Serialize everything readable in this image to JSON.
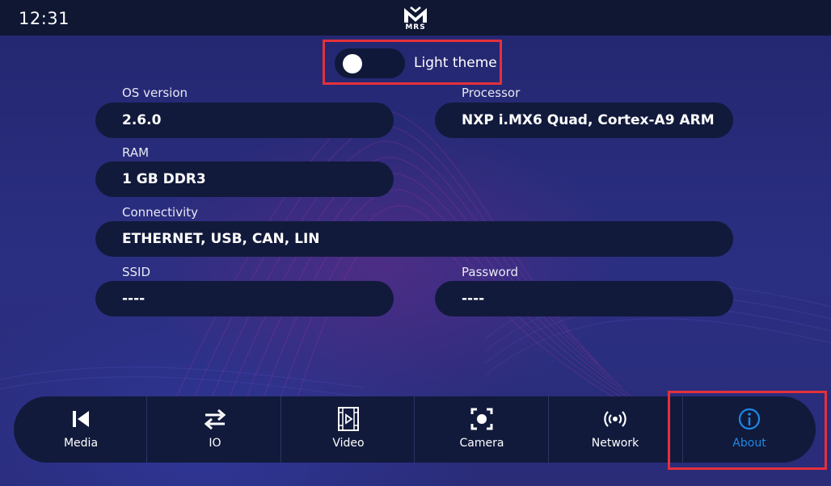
{
  "status_bar": {
    "time": "12:31",
    "logo_text": "MRS"
  },
  "theme_toggle": {
    "label": "Light theme",
    "state": "off"
  },
  "fields": {
    "os_version": {
      "label": "OS version",
      "value": "2.6.0"
    },
    "processor": {
      "label": "Processor",
      "value": "NXP i.MX6 Quad, Cortex-A9 ARM"
    },
    "ram": {
      "label": "RAM",
      "value": "1 GB DDR3"
    },
    "connectivity": {
      "label": "Connectivity",
      "value": "ETHERNET, USB, CAN, LIN"
    },
    "ssid": {
      "label": "SSID",
      "value": "----"
    },
    "password": {
      "label": "Password",
      "value": "----"
    }
  },
  "nav": {
    "items": [
      {
        "label": "Media",
        "icon": "skip-back-icon"
      },
      {
        "label": "IO",
        "icon": "swap-arrows-icon"
      },
      {
        "label": "Video",
        "icon": "film-play-icon"
      },
      {
        "label": "Camera",
        "icon": "camera-focus-icon"
      },
      {
        "label": "Network",
        "icon": "broadcast-icon"
      },
      {
        "label": "About",
        "icon": "info-icon"
      }
    ],
    "active": "About"
  },
  "colors": {
    "background": "#2a2d7a",
    "panel": "#111a3b",
    "topbar": "#101733",
    "active_accent": "#1e88e5",
    "highlight": "#e5303a"
  }
}
